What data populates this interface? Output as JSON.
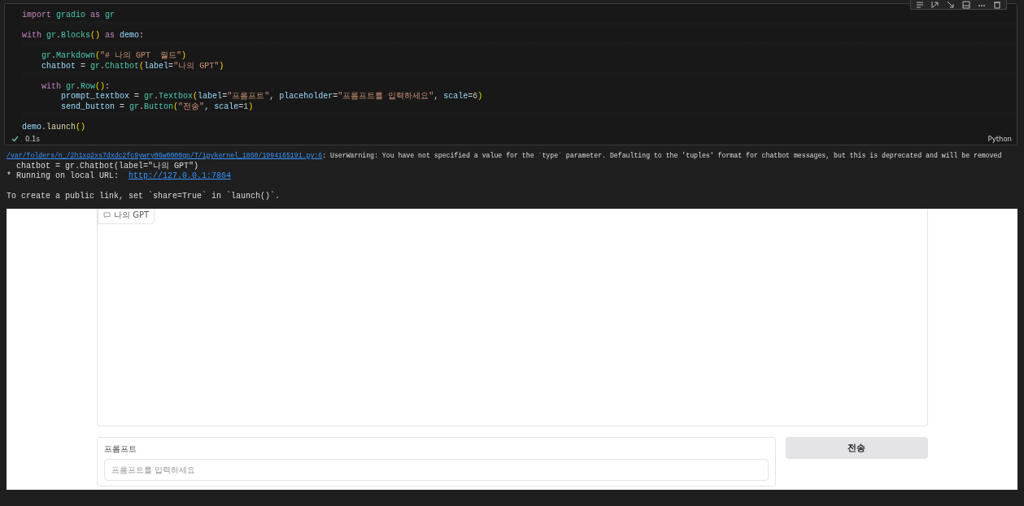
{
  "code_cell": {
    "lines": [
      {
        "gap_before": false,
        "tokens": [
          {
            "kind": "kw",
            "text": "import"
          },
          {
            "kind": "cls",
            "text": " gradio"
          },
          {
            "kind": "kw",
            "text": " as"
          },
          {
            "kind": "cls",
            "text": " gr"
          }
        ]
      },
      {
        "gap_before": true,
        "tokens": [
          {
            "kind": "kw",
            "text": "with"
          },
          {
            "kind": "cls",
            "text": " gr"
          },
          {
            "kind": "plain",
            "text": "."
          },
          {
            "kind": "cls",
            "text": "Blocks"
          },
          {
            "kind": "paren",
            "text": "()"
          },
          {
            "kind": "kw",
            "text": " as"
          },
          {
            "kind": "var",
            "text": " demo"
          },
          {
            "kind": "plain",
            "text": ":"
          }
        ]
      },
      {
        "gap_before": true,
        "tokens": [
          {
            "kind": "cls",
            "text": "    gr"
          },
          {
            "kind": "plain",
            "text": "."
          },
          {
            "kind": "cls",
            "text": "Markdown"
          },
          {
            "kind": "paren",
            "text": "("
          },
          {
            "kind": "str",
            "text": "\"# 나의 GPT  월드\""
          },
          {
            "kind": "paren",
            "text": ")"
          }
        ]
      },
      {
        "gap_before": false,
        "tokens": [
          {
            "kind": "var",
            "text": "    chatbot"
          },
          {
            "kind": "plain",
            "text": " = "
          },
          {
            "kind": "cls",
            "text": "gr"
          },
          {
            "kind": "plain",
            "text": "."
          },
          {
            "kind": "cls",
            "text": "Chatbot"
          },
          {
            "kind": "paren",
            "text": "("
          },
          {
            "kind": "var",
            "text": "label"
          },
          {
            "kind": "plain",
            "text": "="
          },
          {
            "kind": "str",
            "text": "\"나의 GPT\""
          },
          {
            "kind": "paren",
            "text": ")"
          }
        ]
      },
      {
        "gap_before": true,
        "tokens": [
          {
            "kind": "kw",
            "text": "    with"
          },
          {
            "kind": "cls",
            "text": " gr"
          },
          {
            "kind": "plain",
            "text": "."
          },
          {
            "kind": "cls",
            "text": "Row"
          },
          {
            "kind": "paren",
            "text": "()"
          },
          {
            "kind": "plain",
            "text": ":"
          }
        ]
      },
      {
        "gap_before": false,
        "tokens": [
          {
            "kind": "var",
            "text": "        prompt_textbox"
          },
          {
            "kind": "plain",
            "text": " = "
          },
          {
            "kind": "cls",
            "text": "gr"
          },
          {
            "kind": "plain",
            "text": "."
          },
          {
            "kind": "cls",
            "text": "Textbox"
          },
          {
            "kind": "paren",
            "text": "("
          },
          {
            "kind": "var",
            "text": "label"
          },
          {
            "kind": "plain",
            "text": "="
          },
          {
            "kind": "str",
            "text": "\"프롬프트\""
          },
          {
            "kind": "plain",
            "text": ", "
          },
          {
            "kind": "var",
            "text": "placeholder"
          },
          {
            "kind": "plain",
            "text": "="
          },
          {
            "kind": "str",
            "text": "\"프롬프트를 입력하세요\""
          },
          {
            "kind": "plain",
            "text": ", "
          },
          {
            "kind": "var",
            "text": "scale"
          },
          {
            "kind": "plain",
            "text": "="
          },
          {
            "kind": "num",
            "text": "6"
          },
          {
            "kind": "paren",
            "text": ")"
          }
        ]
      },
      {
        "gap_before": false,
        "tokens": [
          {
            "kind": "var",
            "text": "        send_button"
          },
          {
            "kind": "plain",
            "text": " = "
          },
          {
            "kind": "cls",
            "text": "gr"
          },
          {
            "kind": "plain",
            "text": "."
          },
          {
            "kind": "cls",
            "text": "Button"
          },
          {
            "kind": "paren",
            "text": "("
          },
          {
            "kind": "str",
            "text": "\"전송\""
          },
          {
            "kind": "plain",
            "text": ", "
          },
          {
            "kind": "var",
            "text": "scale"
          },
          {
            "kind": "plain",
            "text": "="
          },
          {
            "kind": "num",
            "text": "1"
          },
          {
            "kind": "paren",
            "text": ")"
          }
        ]
      },
      {
        "gap_before": true,
        "tokens": [
          {
            "kind": "var",
            "text": "demo"
          },
          {
            "kind": "plain",
            "text": "."
          },
          {
            "kind": "fn",
            "text": "launch"
          },
          {
            "kind": "paren",
            "text": "()"
          }
        ]
      }
    ],
    "duration": "0.1s",
    "language": "Python"
  },
  "output": {
    "lines": [
      {
        "gap_before": false,
        "kind": "small",
        "segments": [
          {
            "text": "/var/folders/n_/2h1xq2xs7dxdc2fc9ywry06w0000gn/T/ipykernel_1860/1994165191.py:6",
            "link": true
          },
          {
            "text": ": UserWarning: You have not specified a value for the `type` parameter. Defaulting to the 'tuples' format for chatbot messages, but this is deprecated and will be removed",
            "link": false
          }
        ]
      },
      {
        "gap_before": false,
        "kind": "normal",
        "segments": [
          {
            "text": "  chatbot = gr.Chatbot(label=\"나의 GPT\")",
            "link": false
          }
        ]
      },
      {
        "gap_before": false,
        "kind": "normal",
        "segments": [
          {
            "text": "* Running on local URL:  ",
            "link": false
          },
          {
            "text": "http://127.0.0.1:7864",
            "link": true
          }
        ]
      },
      {
        "gap_before": true,
        "kind": "normal",
        "segments": [
          {
            "text": "To create a public link, set `share=True` in `launch()`.",
            "link": false
          }
        ]
      }
    ]
  },
  "app": {
    "chatbot": {
      "label": "나의 GPT"
    },
    "textbox": {
      "label": "프롬프트",
      "placeholder": "프롬프트를 입력하세요"
    },
    "button": {
      "label": "전송"
    }
  }
}
